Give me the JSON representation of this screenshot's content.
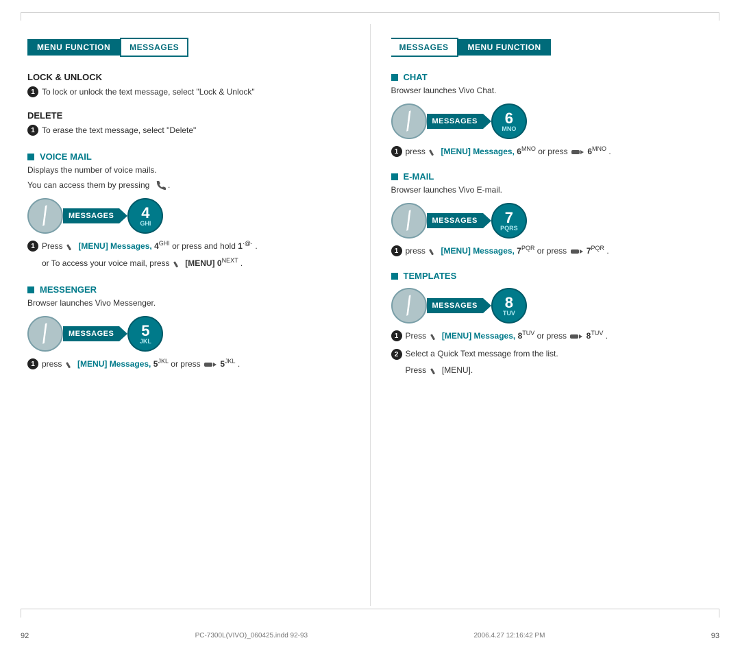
{
  "left_page": {
    "page_number": "92",
    "header": {
      "menu_function": "MENU FUNCTION",
      "messages": "MESSAGES"
    },
    "lock_unlock": {
      "title": "LOCK & UNLOCK",
      "item1": "To lock or unlock the text message, select \"Lock & Unlock\""
    },
    "delete": {
      "title": "DELETE",
      "item1": "To erase the text message, select \"Delete\""
    },
    "voice_mail": {
      "title": "VOICE MAIL",
      "desc1": "Displays the number of voice mails.",
      "desc2": "You can access them by pressing",
      "diagram": {
        "messages_label": "MESSAGES",
        "number": "4",
        "number_sub": "GHI"
      },
      "item1_a": "Press",
      "item1_b": "[MENU] Messages,",
      "item1_c": "4",
      "item1_c_sub": "GHI",
      "item1_d": "or press and hold",
      "item1_e": "1",
      "item1_e_sub": "·@·",
      "item1_f": ".",
      "item1_g": "or To access your voice mail, press",
      "item1_h": "[MENU]",
      "item1_i": "0",
      "item1_i_sub": "NEXT",
      "item1_j": "."
    },
    "messenger": {
      "title": "MESSENGER",
      "desc": "Browser launches Vivo Messenger.",
      "diagram": {
        "messages_label": "MESSAGES",
        "number": "5",
        "number_sub": "JKL"
      },
      "item1_a": "press",
      "item1_b": "[MENU] Messages,",
      "item1_c": "5",
      "item1_c_sub": "JKL",
      "item1_d": "or press",
      "item1_e": "5",
      "item1_e_sub": "JKL",
      "item1_f": "."
    }
  },
  "right_page": {
    "page_number": "93",
    "header": {
      "messages": "MESSAGES",
      "menu_function": "MENU FUNCTION"
    },
    "chat": {
      "title": "CHAT",
      "desc": "Browser launches Vivo Chat.",
      "diagram": {
        "messages_label": "MESSAGES",
        "number": "6",
        "number_sub": "MNO"
      },
      "item1_a": "press",
      "item1_b": "[MENU] Messages,",
      "item1_c": "6",
      "item1_c_sub": "MNO",
      "item1_d": "or press",
      "item1_e": "6",
      "item1_e_sub": "MNO",
      "item1_f": "."
    },
    "email": {
      "title": "E-MAIL",
      "desc": "Browser launches Vivo E-mail.",
      "diagram": {
        "messages_label": "MESSAGES",
        "number": "7",
        "number_sub": "PQRS"
      },
      "item1_a": "press",
      "item1_b": "[MENU] Messages,",
      "item1_c": "7",
      "item1_c_sub": "PQR",
      "item1_d": "or press",
      "item1_e": "7",
      "item1_e_sub": "PQR",
      "item1_f": "."
    },
    "templates": {
      "title": "TEMPLATES",
      "diagram": {
        "messages_label": "MESSAGES",
        "number": "8",
        "number_sub": "TUV"
      },
      "item1_a": "Press",
      "item1_b": "[MENU] Messages,",
      "item1_c": "8",
      "item1_c_sub": "TUV",
      "item1_d": "or press",
      "item1_e": "8",
      "item1_e_sub": "TUV",
      "item1_f": ".",
      "item2_a": "Select a Quick Text message from the list.",
      "item2_b": "Press",
      "item2_c": "[MENU]."
    }
  },
  "footer": {
    "left_page_num": "92",
    "right_page_num": "93",
    "file_info": "PC-7300L(VIVO)_060425.indd   92-93",
    "date_info": "2006.4.27   12:16:42 PM"
  }
}
